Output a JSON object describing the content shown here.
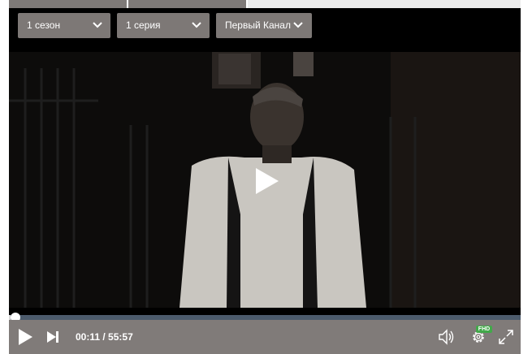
{
  "selectors": {
    "season": "1 сезон",
    "episode": "1 серия",
    "channel": "Первый Канал"
  },
  "player": {
    "current_time": "00:11",
    "duration": "55:57",
    "quality_badge": "FHD",
    "progress_fraction": 0.0033,
    "colors": {
      "progress_track": "#4c5b6c",
      "control_bar": "#807b79",
      "quality_badge": "#42a84a"
    }
  },
  "icons": [
    "chevron-down-icon",
    "play-icon",
    "next-icon",
    "volume-icon",
    "gear-icon",
    "fullscreen-icon"
  ]
}
